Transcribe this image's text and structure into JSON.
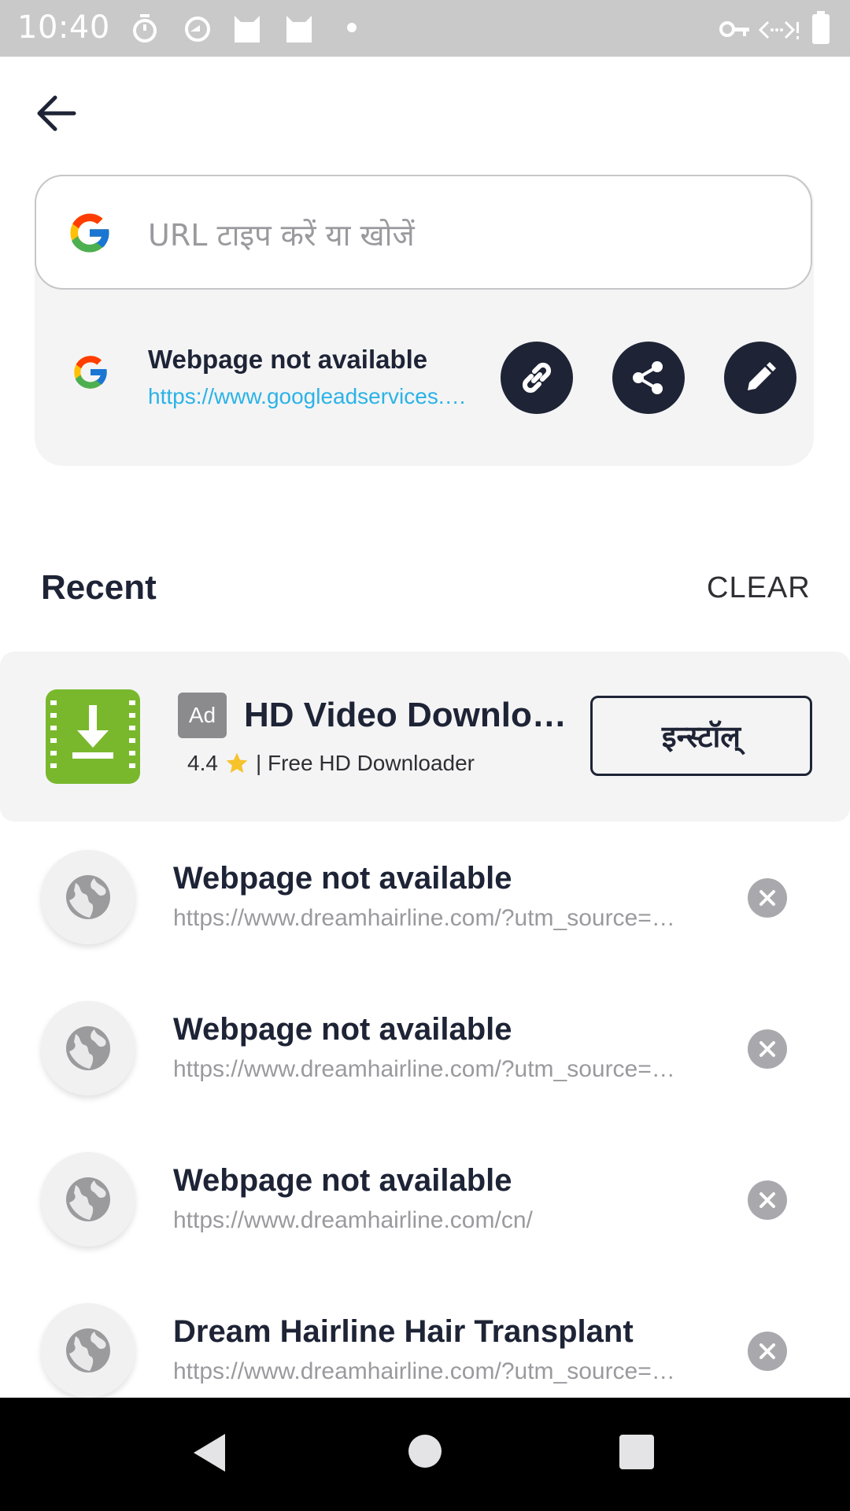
{
  "status_bar": {
    "time": "10:40",
    "icons": [
      "timer-icon",
      "sync-icon",
      "cat-icon",
      "cat-icon",
      "dot-icon",
      "vpn-key-icon",
      "data-arrows-icon",
      "battery-icon"
    ]
  },
  "search": {
    "placeholder": "URL टाइप करें या खोजें"
  },
  "clipboard": {
    "title": "Webpage not available",
    "url": "https://www.googleadservices.com/",
    "actions": [
      "link-icon",
      "share-icon",
      "edit-icon"
    ]
  },
  "recent": {
    "title": "Recent",
    "clear_label": "CLEAR"
  },
  "ad": {
    "badge": "Ad",
    "title": "HD Video Downloader",
    "rating": "4.4",
    "subtitle": "| Free HD Downloader",
    "install_label": "इन्स्टॉल्"
  },
  "history": [
    {
      "title": "Webpage not available",
      "url": "https://www.dreamhairline.com/?utm_source=google"
    },
    {
      "title": "Webpage not available",
      "url": "https://www.dreamhairline.com/?utm_source=google"
    },
    {
      "title": "Webpage not available",
      "url": "https://www.dreamhairline.com/cn/"
    },
    {
      "title": "Dream Hairline Hair Transplant",
      "url": "https://www.dreamhairline.com/?utm_source=google"
    }
  ],
  "colors": {
    "dark": "#1e2436",
    "link": "#2bb3e6",
    "ad_icon": "#79b82c",
    "card_bg": "#f4f4f5"
  }
}
